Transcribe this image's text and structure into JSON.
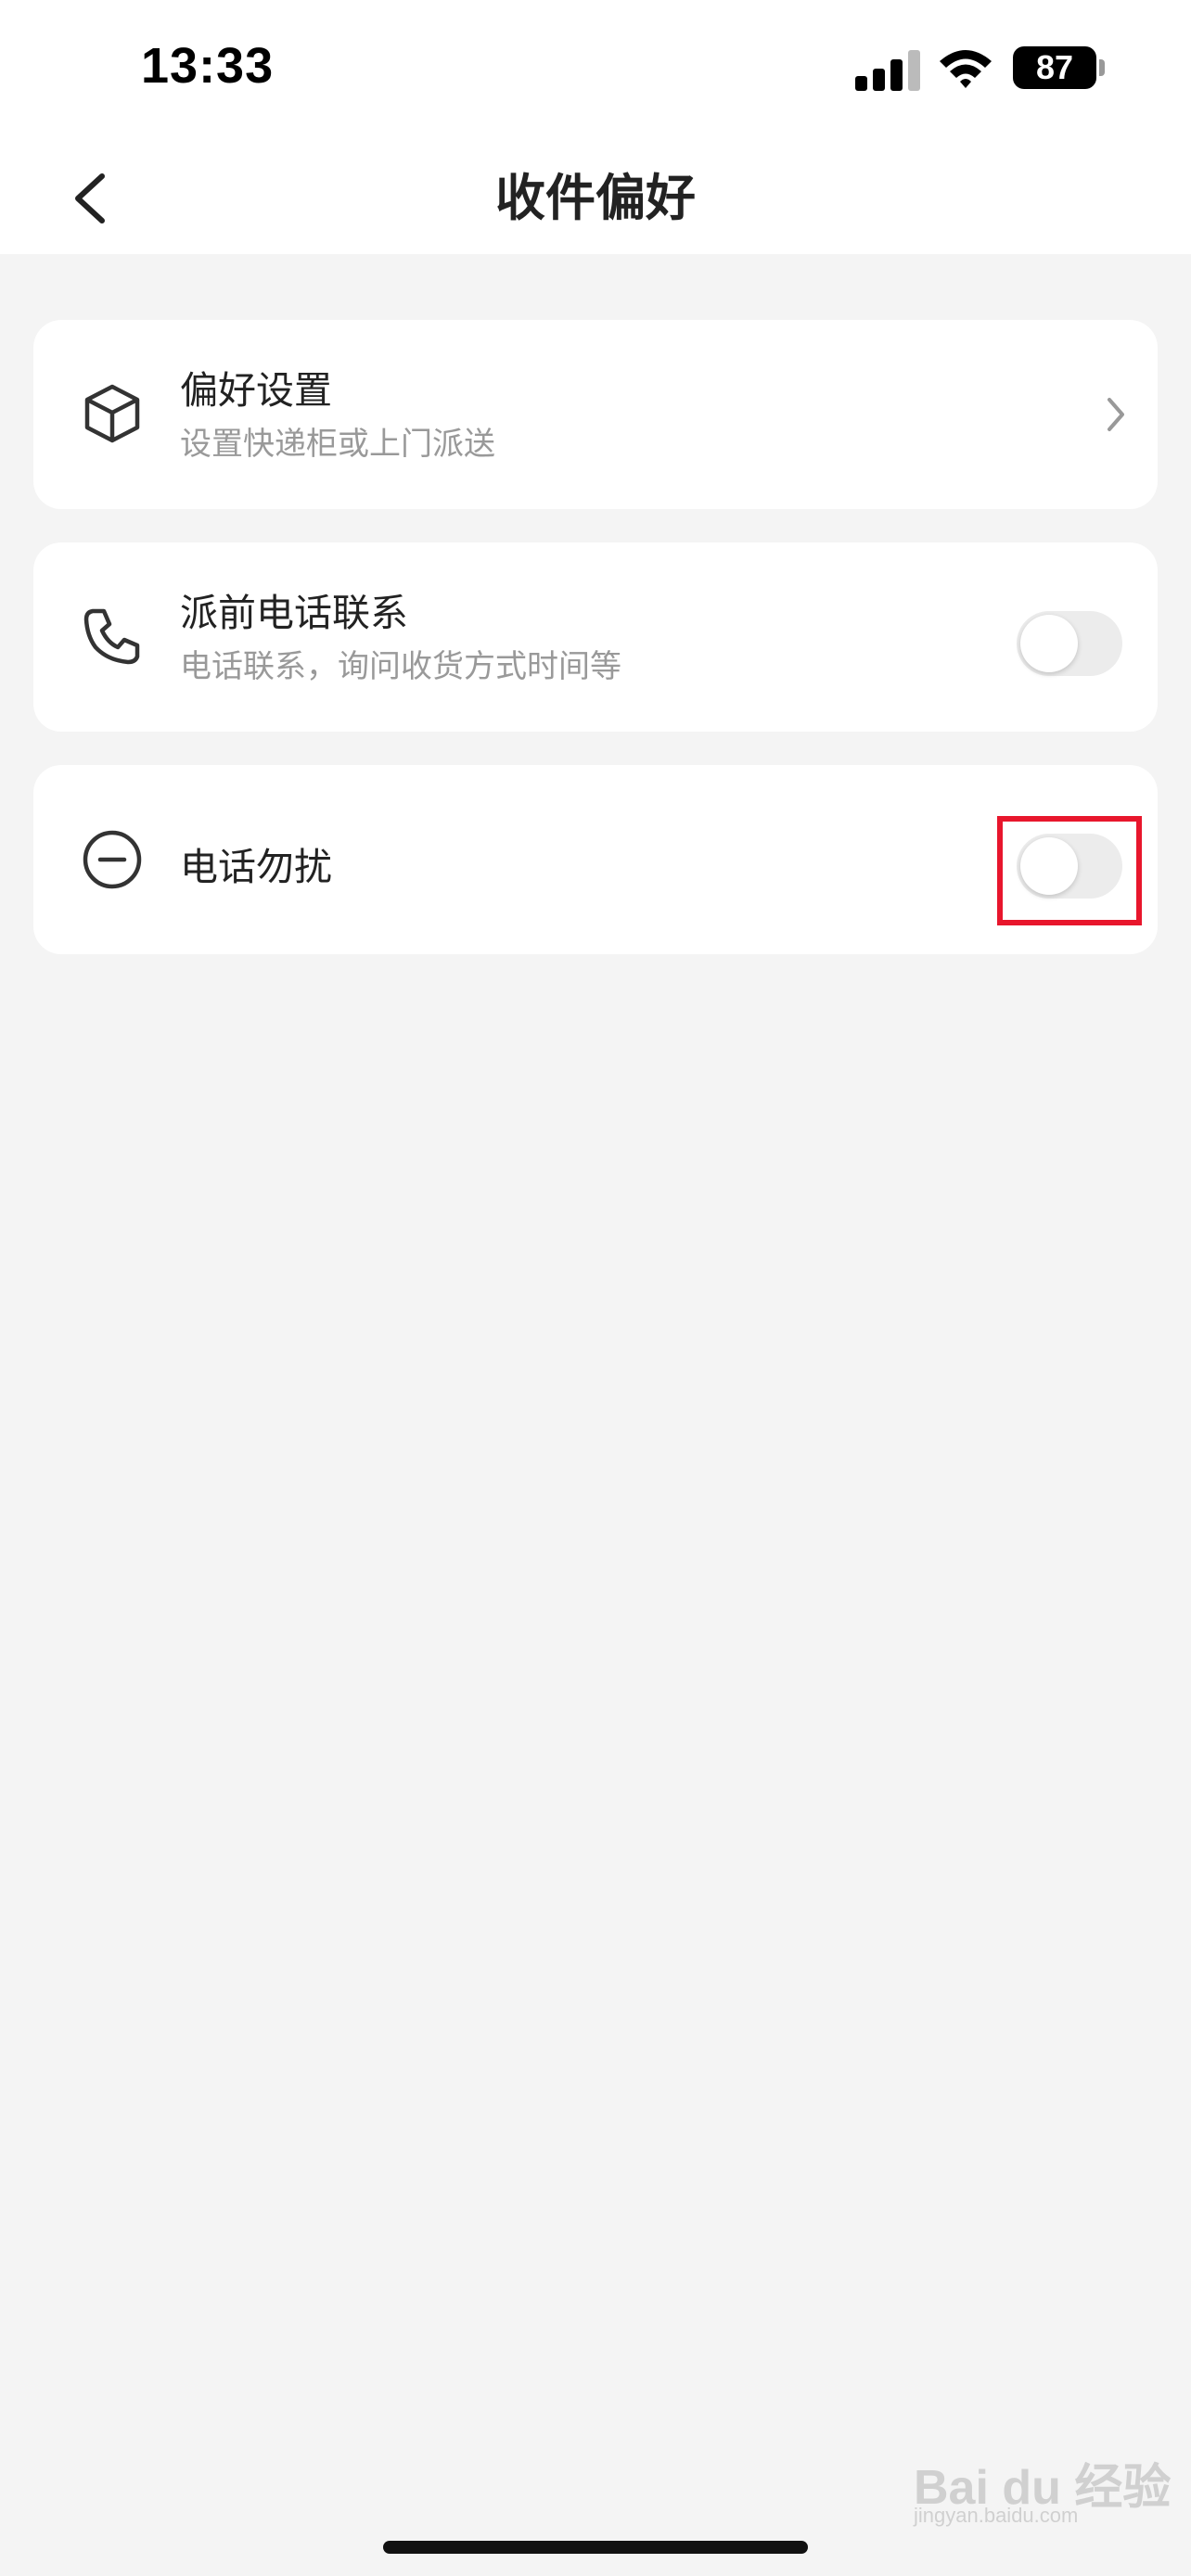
{
  "status_bar": {
    "time": "13:33",
    "battery": "87",
    "icons": [
      "signal-icon",
      "wifi-icon",
      "battery-icon"
    ]
  },
  "nav": {
    "title": "收件偏好",
    "back_icon": "chevron-left-icon"
  },
  "items": [
    {
      "icon": "box-icon",
      "title": "偏好设置",
      "subtitle": "设置快递柜或上门派送",
      "control": "chevron-right-icon"
    },
    {
      "icon": "phone-icon",
      "title": "派前电话联系",
      "subtitle": "电话联系，询问收货方式时间等",
      "control": "toggle",
      "toggle_on": false
    },
    {
      "icon": "minus-circle-icon",
      "title": "电话勿扰",
      "control": "toggle",
      "toggle_on": false,
      "highlighted": true
    }
  ],
  "colors": {
    "background": "#f4f4f4",
    "card": "#ffffff",
    "highlight": "#e8162c",
    "toggle_off": "#ececec"
  },
  "watermark": {
    "brand": "Bai du 经验",
    "site": "jingyan.baidu.com"
  }
}
